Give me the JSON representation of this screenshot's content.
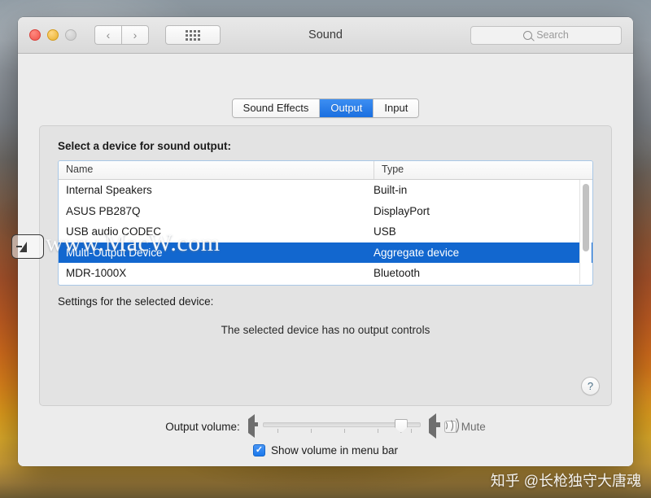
{
  "window": {
    "title": "Sound",
    "traffic_lights": [
      "close",
      "minimize",
      "zoom"
    ],
    "nav": {
      "back": "‹",
      "forward": "›"
    },
    "grid_button": "show-all-grid",
    "search": {
      "placeholder": "Search",
      "value": ""
    }
  },
  "tabs": [
    {
      "label": "Sound Effects",
      "active": false
    },
    {
      "label": "Output",
      "active": true
    },
    {
      "label": "Input",
      "active": false
    }
  ],
  "panel": {
    "heading": "Select a device for sound output:",
    "settings_label": "Settings for the selected device:",
    "no_controls_message": "The selected device has no output controls",
    "help_label": "?"
  },
  "device_table": {
    "columns": [
      "Name",
      "Type"
    ],
    "rows": [
      {
        "name": "Internal Speakers",
        "type": "Built-in",
        "selected": false
      },
      {
        "name": "ASUS PB287Q",
        "type": "DisplayPort",
        "selected": false
      },
      {
        "name": "USB audio CODEC",
        "type": "USB",
        "selected": false
      },
      {
        "name": "Multi-Output Device",
        "type": "Aggregate device",
        "selected": true
      },
      {
        "name": "MDR-1000X",
        "type": "Bluetooth",
        "selected": false
      }
    ]
  },
  "volume": {
    "label": "Output volume:",
    "slider_percent": 90,
    "tick_count": 5,
    "low_icon": "speaker-low-icon",
    "high_icon": "speaker-high-icon",
    "mute": {
      "label": "Mute",
      "checked": false
    },
    "show_in_menu_bar": {
      "label": "Show volume in menu bar",
      "checked": true
    }
  },
  "watermarks": {
    "site": "www.MacW.com",
    "author": "知乎 @长枪独守大唐魂"
  },
  "colors": {
    "accent_blue": "#1267cf",
    "tab_active": "#3d8ef2",
    "list_border": "#a8c7e6",
    "window_bg": "#ececec",
    "panel_bg": "#e3e3e3"
  }
}
